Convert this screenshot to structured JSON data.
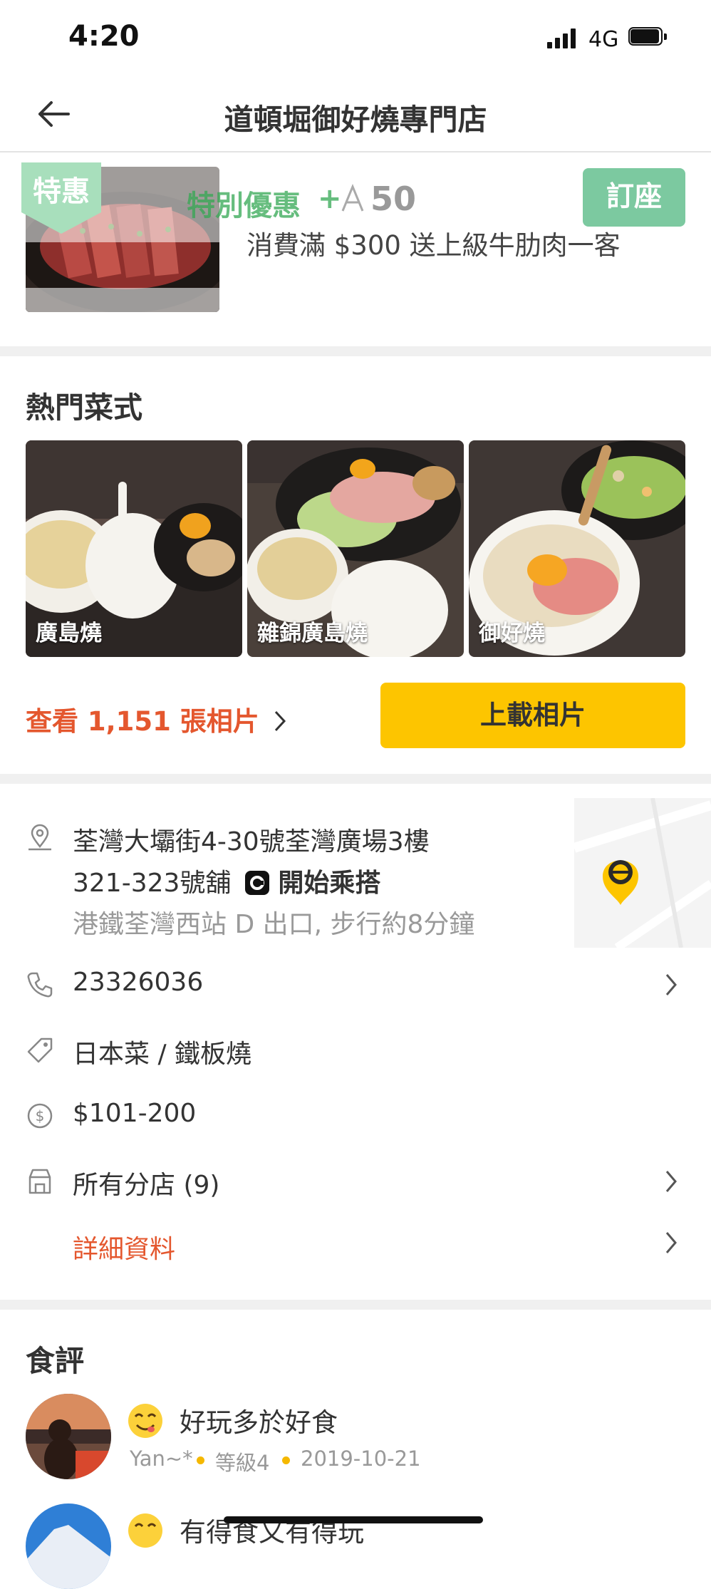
{
  "status_bar": {
    "time": "4:20",
    "network": "4G"
  },
  "header": {
    "title": "道頓堀御好燒專門店"
  },
  "deal": {
    "tag": "特惠",
    "title": "特別優惠",
    "plus": "+",
    "points": "50",
    "reserve_label": "訂座",
    "description": "消費滿 $300 送上級牛肋肉一客"
  },
  "popular": {
    "title": "熱門菜式",
    "dishes": [
      {
        "label": "廣島燒"
      },
      {
        "label": "雜錦廣島燒"
      },
      {
        "label": "御好燒"
      }
    ],
    "view_photos": "查看 1,151 張相片",
    "upload_label": "上載相片"
  },
  "info": {
    "address_line1": "荃灣大壩街4-30號荃灣廣場3樓",
    "address_line2": "321-323號舖",
    "ride_label": "開始乘搭",
    "directions": "港鐵荃灣西站 D 出口, 步行約8分鐘",
    "phone": "23326036",
    "cuisine": "日本菜 / 鐵板燒",
    "price_range": "$101-200",
    "branches": "所有分店 (9)",
    "details": "詳細資料"
  },
  "reviews": {
    "title": "食評",
    "items": [
      {
        "title": "好玩多於好食",
        "user": "Yan~*",
        "level": "等級4",
        "date": "2019-10-21"
      },
      {
        "title": "有得食又有得玩"
      }
    ]
  },
  "colors": {
    "accent_orange": "#e4572e",
    "yellow": "#fdc500",
    "green": "#34a853",
    "reserve_green": "#7cc9a0"
  }
}
